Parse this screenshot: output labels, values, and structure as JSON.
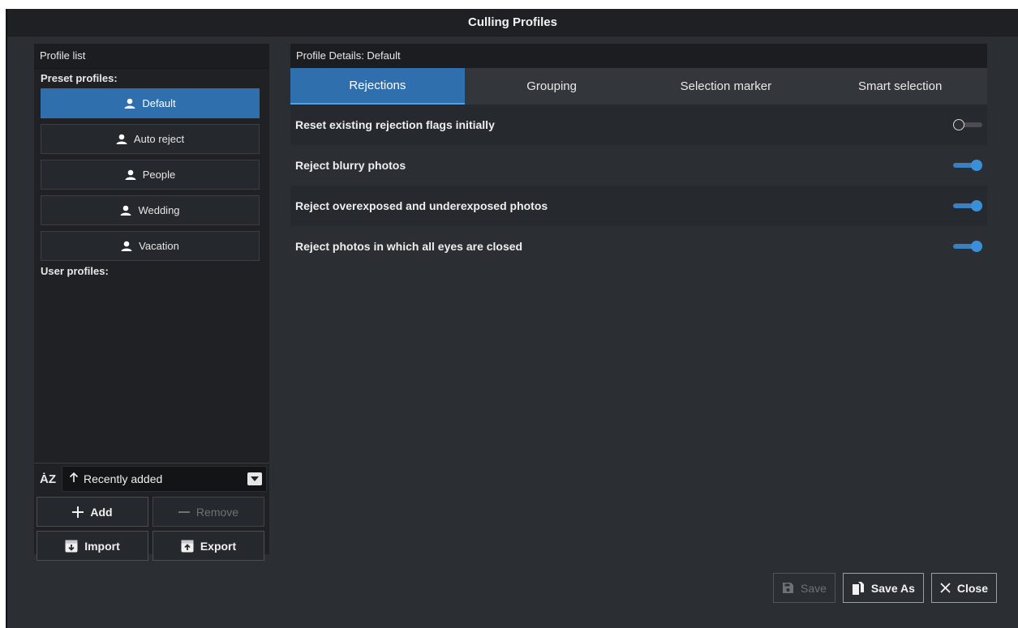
{
  "window": {
    "title": "Culling Profiles"
  },
  "profile_list": {
    "header": "Profile list",
    "preset_label": "Preset profiles:",
    "user_label": "User profiles:",
    "presets": [
      {
        "label": "Default",
        "selected": true
      },
      {
        "label": "Auto reject",
        "selected": false
      },
      {
        "label": "People",
        "selected": false
      },
      {
        "label": "Wedding",
        "selected": false
      },
      {
        "label": "Vacation",
        "selected": false
      }
    ],
    "sort": {
      "icon": "sort-az-icon",
      "value": "Recently added"
    },
    "buttons": {
      "add": "Add",
      "remove": "Remove",
      "import": "Import",
      "export": "Export"
    }
  },
  "details": {
    "header": "Profile Details: Default",
    "tabs": [
      "Rejections",
      "Grouping",
      "Selection marker",
      "Smart selection"
    ],
    "active_tab": "Rejections",
    "options": [
      {
        "label": "Reset existing rejection flags initially",
        "enabled": false
      },
      {
        "label": "Reject blurry photos",
        "enabled": true
      },
      {
        "label": "Reject overexposed and underexposed photos",
        "enabled": true
      },
      {
        "label": "Reject photos in which all eyes are closed",
        "enabled": true
      }
    ]
  },
  "footer": {
    "save": "Save",
    "save_as": "Save As",
    "close": "Close"
  },
  "colors": {
    "accent": "#2f6fae",
    "background": "#2b2e33",
    "panel": "#1f2124"
  }
}
